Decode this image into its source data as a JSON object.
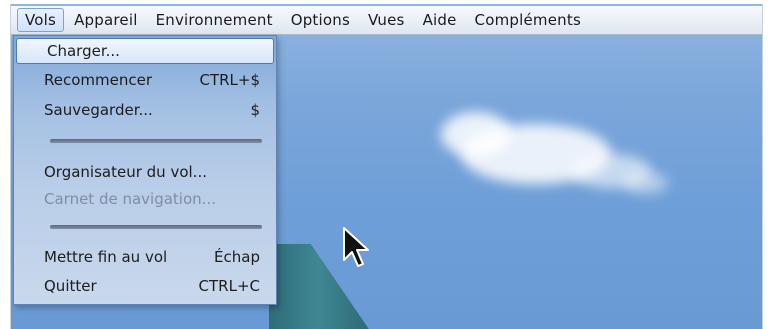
{
  "menubar": {
    "items": [
      {
        "label": "Vols"
      },
      {
        "label": "Appareil"
      },
      {
        "label": "Environnement"
      },
      {
        "label": "Options"
      },
      {
        "label": "Vues"
      },
      {
        "label": "Aide"
      },
      {
        "label": "Compléments"
      }
    ]
  },
  "dropdown": {
    "items": [
      {
        "label": "Charger...",
        "shortcut": ""
      },
      {
        "label": "Recommencer",
        "shortcut": "CTRL+$"
      },
      {
        "label": "Sauvegarder...",
        "shortcut": "$"
      },
      {
        "label": "Organisateur du vol...",
        "shortcut": ""
      },
      {
        "label": "Carnet de navigation...",
        "shortcut": ""
      },
      {
        "label": "Mettre fin au vol",
        "shortcut": "Échap"
      },
      {
        "label": "Quitter",
        "shortcut": "CTRL+C"
      }
    ]
  },
  "scene": {
    "cursor_icon": "mouse-pointer-icon"
  }
}
